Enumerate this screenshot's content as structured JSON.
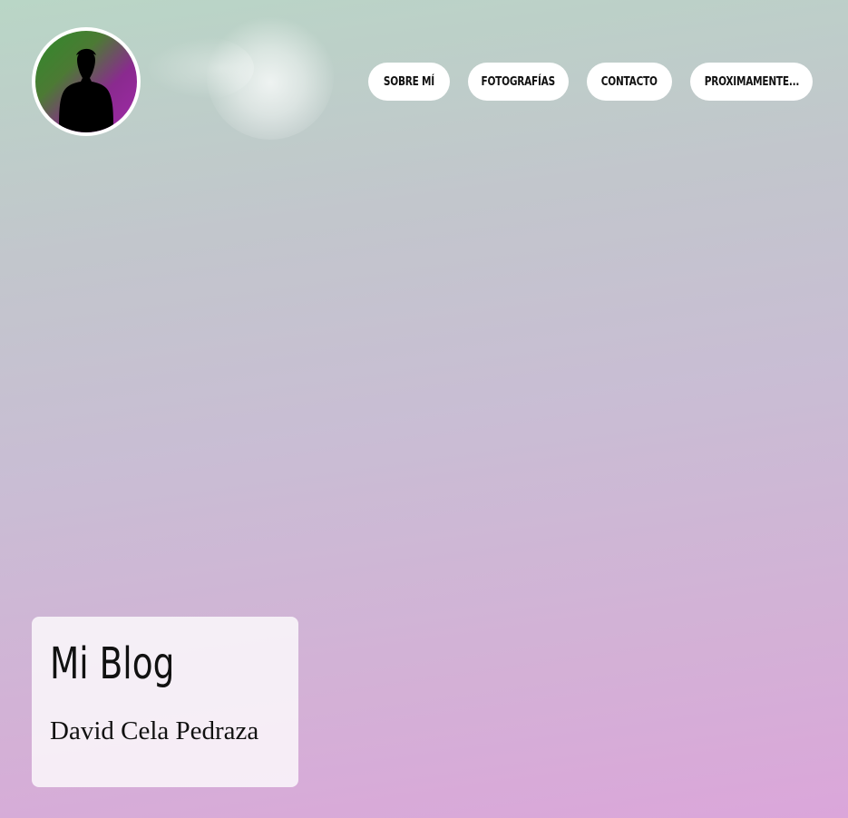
{
  "header": {
    "avatar_icon": "person-silhouette-icon",
    "nav": [
      {
        "label": "SOBRE MÍ",
        "width": 90
      },
      {
        "label": "FOTOGRAFÍAS",
        "width": 111
      },
      {
        "label": "CONTACTO",
        "width": 94
      },
      {
        "label": "PROXIMAMENTE...",
        "width": 135
      }
    ]
  },
  "hero": {
    "title": "Mi Blog",
    "author": "David Cela Pedraza"
  },
  "colors": {
    "background_top": "#b9d6c6",
    "background_bottom": "#dba6da",
    "card_background": "#ffffff",
    "text": "#111111"
  }
}
